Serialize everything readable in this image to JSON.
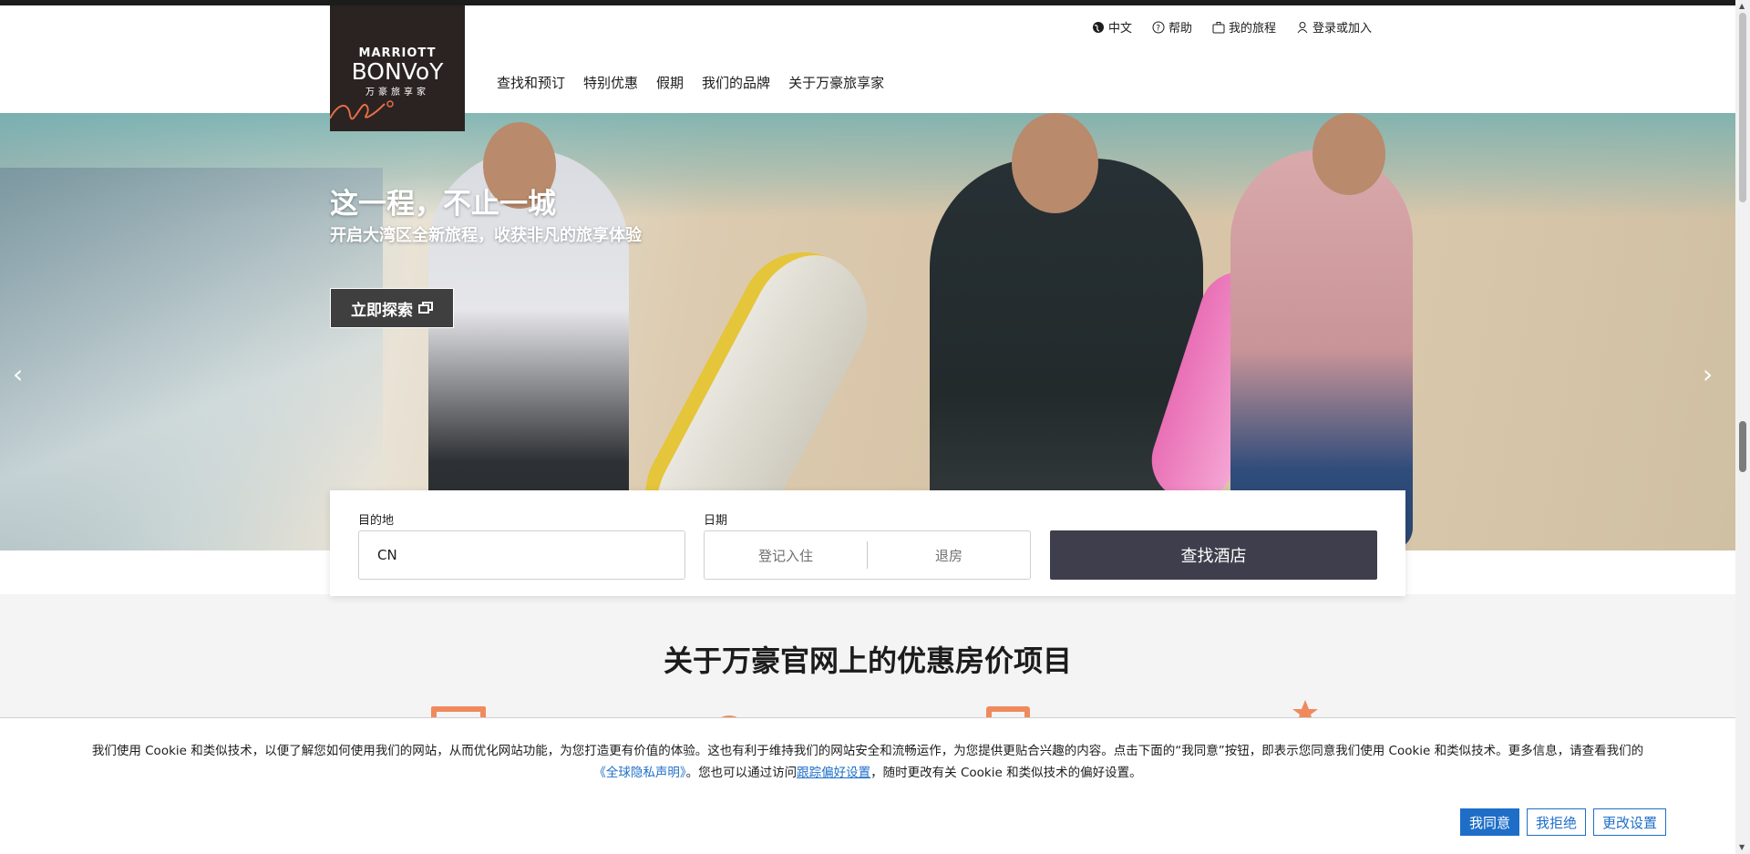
{
  "brand": {
    "line1": "MARRIOTT",
    "line2": "BONVoY",
    "line3": "万豪旅享家"
  },
  "utility": [
    {
      "label": "中文",
      "icon": "globe-icon"
    },
    {
      "label": "帮助",
      "icon": "help-circle-icon"
    },
    {
      "label": "我的旅程",
      "icon": "suitcase-icon"
    },
    {
      "label": "登录或加入",
      "icon": "user-icon"
    }
  ],
  "nav": [
    "查找和预订",
    "特别优惠",
    "假期",
    "我们的品牌",
    "关于万豪旅享家"
  ],
  "hero": {
    "title": "这一程，不止一城",
    "subtitle": "开启大湾区全新旅程，收获非凡的旅享体验",
    "cta": "立即探索",
    "slides": 4,
    "active_slide": 4
  },
  "search": {
    "destination_label": "目的地",
    "destination_value": "CN",
    "dates_label": "日期",
    "checkin_placeholder": "登记入住",
    "checkout_placeholder": "退房",
    "find_label": "查找酒店"
  },
  "section": {
    "title": "关于万豪官网上的优惠房价项目"
  },
  "cookie": {
    "text_1": "我们使用 Cookie 和类似技术，以便了解您如何使用我们的网站，从而优化网站功能，为您打造更有价值的体验。这也有利于维持我们的网站安全和流畅运作，为您提供更贴合兴趣的内容。点击下面的“我同意”按钮，即表示您同意我们使用 Cookie 和类似技术。更多信息，请查看我们的",
    "privacy_link": "《全球隐私声明》",
    "text_2": "。您也可以通过访问",
    "tracking_link": "跟踪偏好设置",
    "text_3": "，随时更改有关 Cookie 和类似技术的偏好设置。",
    "agree": "我同意",
    "reject": "我拒绝",
    "settings": "更改设置"
  },
  "colors": {
    "accent": "#e46d47",
    "button_dark": "#3f3e4c",
    "link_blue": "#1e6ec8"
  }
}
